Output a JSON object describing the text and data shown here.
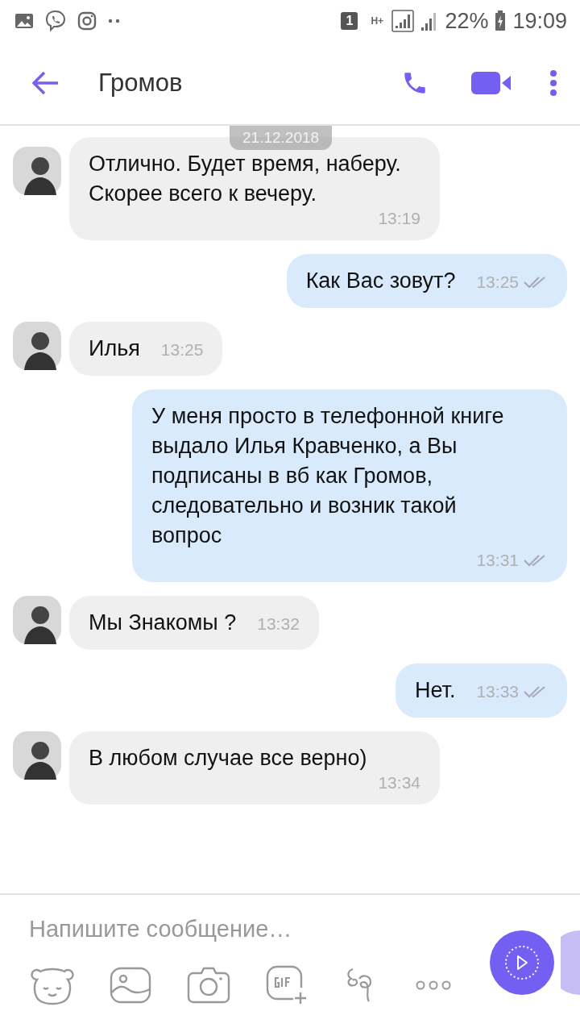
{
  "status_bar": {
    "sim": "1",
    "network": "H+",
    "battery": "22%",
    "time": "19:09"
  },
  "header": {
    "title": "Громов"
  },
  "date_pill": "21.12.2018",
  "messages": [
    {
      "kind": "incoming",
      "text": "Отлично. Будет время, наберу. Скорее всего к вечеру.",
      "time": "13:19"
    },
    {
      "kind": "outgoing",
      "text": "Как Вас зовут?",
      "time": "13:25",
      "read": true
    },
    {
      "kind": "incoming",
      "text": "Илья",
      "time": "13:25"
    },
    {
      "kind": "outgoing",
      "text": "У меня просто в телефонной книге выдало Илья Кравченко, а Вы подписаны в вб как Громов, следовательно и возник такой вопрос",
      "time": "13:31",
      "read": true
    },
    {
      "kind": "incoming",
      "text": "Мы Знакомы ?",
      "time": "13:32"
    },
    {
      "kind": "outgoing",
      "text": "Нет.",
      "time": "13:33",
      "read": true
    },
    {
      "kind": "incoming",
      "text": "В любом случае все верно)",
      "time": "13:34"
    }
  ],
  "composer": {
    "placeholder": "Напишите сообщение…"
  }
}
